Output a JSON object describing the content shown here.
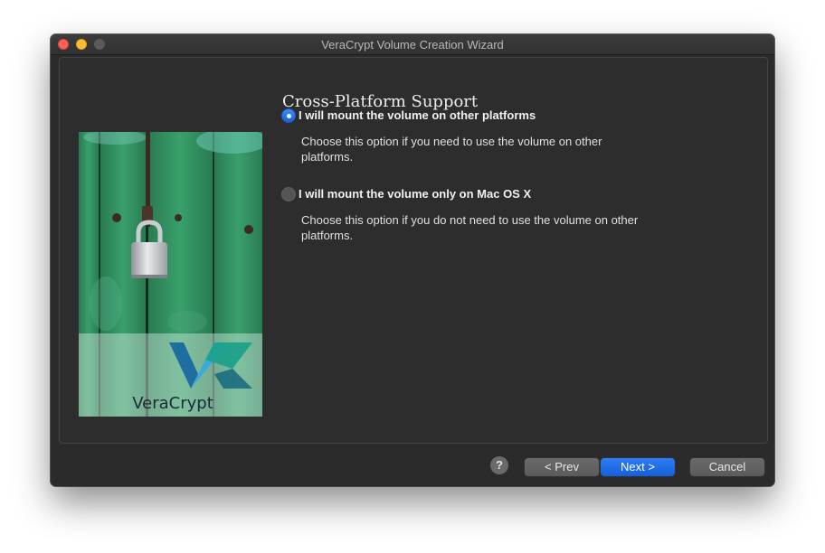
{
  "window": {
    "title": "VeraCrypt Volume Creation Wizard"
  },
  "page": {
    "heading": "Cross-Platform Support"
  },
  "side_image": {
    "brand": "VeraCrypt",
    "icon": "padlock-on-green-door"
  },
  "options": [
    {
      "label": "I will mount the volume on other platforms",
      "description": "Choose this option if you need to use the volume on other platforms.",
      "selected": true
    },
    {
      "label": "I will mount the volume only on Mac OS X",
      "description": "Choose this option if you do not need to use the volume on other platforms.",
      "selected": false
    }
  ],
  "footer": {
    "help_label": "?",
    "prev_label": "< Prev",
    "next_label": "Next >",
    "cancel_label": "Cancel"
  },
  "colors": {
    "accent": "#1a64dc",
    "window_bg": "#2b2b2b",
    "door_green": "#2f8a5a"
  }
}
